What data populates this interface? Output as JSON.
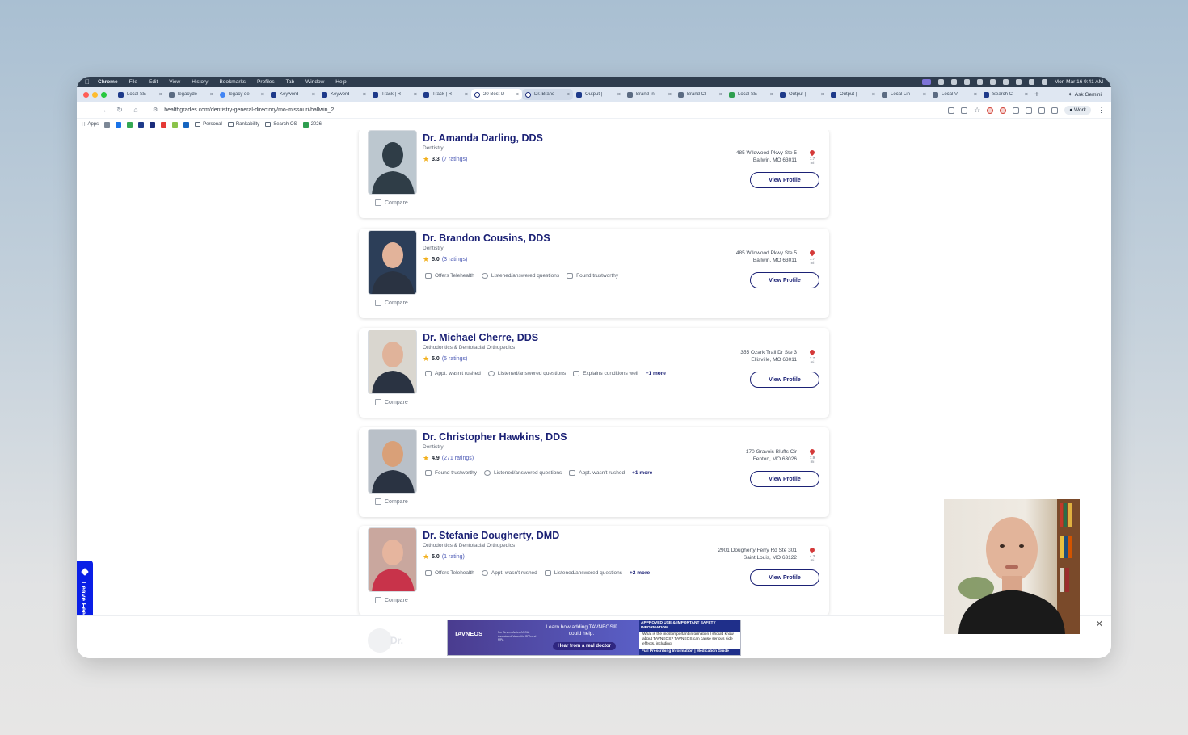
{
  "menubar": {
    "items": [
      "Chrome",
      "File",
      "Edit",
      "View",
      "History",
      "Bookmarks",
      "Profiles",
      "Tab",
      "Window",
      "Help"
    ],
    "clock": "Mon Mar 16  9:41 AM"
  },
  "tabs": [
    {
      "label": "Local SE",
      "fav": "r"
    },
    {
      "label": "legacyde",
      "fav": ""
    },
    {
      "label": "legacy de",
      "fav": "g"
    },
    {
      "label": "Keyword",
      "fav": "r"
    },
    {
      "label": "Keyword",
      "fav": "r"
    },
    {
      "label": "Track | R",
      "fav": "r"
    },
    {
      "label": "Track | R",
      "fav": "r"
    },
    {
      "label": "20 Best D",
      "fav": "h",
      "state": "active"
    },
    {
      "label": "Dr. Brand",
      "fav": "h",
      "state": "hover"
    },
    {
      "label": "Output |",
      "fav": "r"
    },
    {
      "label": "Brand In",
      "fav": ""
    },
    {
      "label": "Brand Cl",
      "fav": ""
    },
    {
      "label": "Local SE",
      "fav": "gr"
    },
    {
      "label": "Output |",
      "fav": "r"
    },
    {
      "label": "Output |",
      "fav": "r"
    },
    {
      "label": "Local Lin",
      "fav": ""
    },
    {
      "label": "Local Vi",
      "fav": ""
    },
    {
      "label": "Search C",
      "fav": "r"
    }
  ],
  "ask_gemini": "Ask Gemini",
  "url": "healthgrades.com/dentistry-general-directory/mo-missouri/ballwin_2",
  "work_profile": "Work",
  "bookmarks": {
    "apps": "Apps",
    "folders": [
      "Personal",
      "Rankability",
      "Search OS",
      "2026"
    ]
  },
  "compare_label": "Compare",
  "view_profile_label": "View Profile",
  "feedback_label": "Leave Feedback",
  "doctors": [
    {
      "name": "Dr. Amanda Darling, DDS",
      "specialty": "Dentistry",
      "rating": "3.3",
      "ratings_count": "(7 ratings)",
      "address1": "485 Wildwood Pkwy Ste 5",
      "address2": "Ballwin, MO 63011",
      "distance": "1.7 mi",
      "attributes": [],
      "more": ""
    },
    {
      "name": "Dr. Brandon Cousins, DDS",
      "specialty": "Dentistry",
      "rating": "5.0",
      "ratings_count": "(3 ratings)",
      "address1": "485 Wildwood Pkwy Ste 5",
      "address2": "Ballwin, MO 63011",
      "distance": "1.7 mi",
      "attributes": [
        "Offers Telehealth",
        "Listened/answered questions",
        "Found trustworthy"
      ],
      "more": ""
    },
    {
      "name": "Dr. Michael Cherre, DDS",
      "specialty": "Orthodontics & Dentofacial Orthopedics",
      "rating": "5.0",
      "ratings_count": "(5 ratings)",
      "address1": "355 Ozark Trail Dr Ste 3",
      "address2": "Ellisville, MO 63011",
      "distance": "2.7 mi",
      "attributes": [
        "Appt. wasn't rushed",
        "Listened/answered questions",
        "Explains conditions well"
      ],
      "more": "+1 more"
    },
    {
      "name": "Dr. Christopher Hawkins, DDS",
      "specialty": "Dentistry",
      "rating": "4.9",
      "ratings_count": "(271 ratings)",
      "address1": "170 Gravois Bluffs Cir",
      "address2": "Fenton, MO 63026",
      "distance": "7.9 mi",
      "attributes": [
        "Found trustworthy",
        "Listened/answered questions",
        "Appt. wasn't rushed"
      ],
      "more": "+1 more"
    },
    {
      "name": "Dr. Stefanie Dougherty, DMD",
      "specialty": "Orthodontics & Dentofacial Orthopedics",
      "rating": "5.0",
      "ratings_count": "(1 rating)",
      "address1": "2901 Dougherty Ferry Rd Ste 301",
      "address2": "Saint Louis, MO 63122",
      "distance": "4.3 mi",
      "attributes": [
        "Offers Telehealth",
        "Appt. wasn't rushed",
        "Listened/answered questions"
      ],
      "more": "+2 more"
    }
  ],
  "ad": {
    "brand": "TAVNEOS",
    "brand_sub": "For Severe Active ANCA-Associated Vasculitis GPA and MPA",
    "message": "Learn how adding TAVNEOS® could help.",
    "cta": "Hear from a real doctor",
    "safety_header": "APPROVED USE & IMPORTANT SAFETY INFORMATION",
    "safety_text": "What is the most important information I should know about TAVNEOS? TAVNEOS can cause serious side effects, including:",
    "footer": "Full Prescribing Information | Medication Guide"
  },
  "ghost_name": "Dr.",
  "colors": {
    "navy": "#1b2175",
    "star": "#f2b01e",
    "pin": "#d43a3a",
    "feedback": "#0a1fe6"
  }
}
